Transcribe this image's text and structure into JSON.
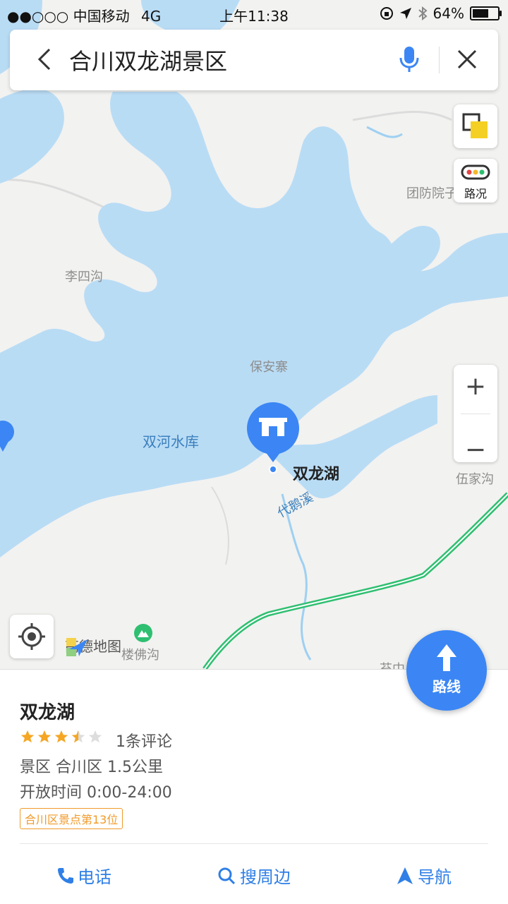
{
  "status_bar": {
    "carrier": "●●○○○ 中国移动",
    "network": "4G",
    "time": "上午11:38",
    "battery": "64%",
    "battery_level": 0.64
  },
  "search": {
    "query": "合川双龙湖景区"
  },
  "map": {
    "traffic_label": "路况",
    "labels": {
      "tuanfang": "团防院子",
      "lisigou": "李四沟",
      "baoanzhai": "保安寨",
      "shuanghe": "双河水库",
      "shuanglonghu": "双龙湖",
      "daijuxi": "代鹅溪",
      "wujiagou": "伍家沟",
      "loufogou": "楼佛沟",
      "bottom_partial": "苔中"
    },
    "logo_text": "高德地图",
    "zoom_in": "+",
    "zoom_out": "−",
    "colors": {
      "water": "#b9dcf5",
      "land": "#f2f2f0",
      "road_green": "#2fbf71",
      "accent": "#3b86f4"
    }
  },
  "route_button": {
    "label": "路线"
  },
  "place": {
    "name": "双龙湖",
    "rating": 3.5,
    "rating_max": 5,
    "reviews": "1条评论",
    "category_line": "景区  合川区  1.5公里",
    "hours": "开放时间 0:00-24:00",
    "rank_badge": "合川区景点第13位"
  },
  "actions": {
    "call": "电话",
    "nearby": "搜周边",
    "navigate": "导航"
  }
}
